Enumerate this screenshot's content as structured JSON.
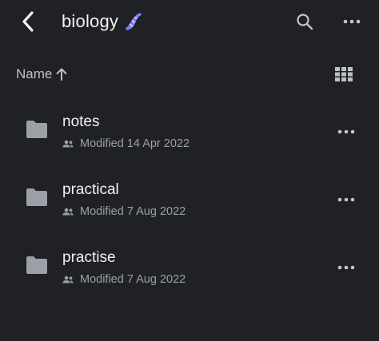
{
  "header": {
    "back_icon": "chevron-left-icon",
    "title": "biology",
    "title_emoji": "dna-icon",
    "search_icon": "search-icon",
    "more_icon": "more-horizontal-icon"
  },
  "sortbar": {
    "label": "Name",
    "direction": "ascending",
    "arrow_icon": "arrow-up-icon",
    "view_toggle_icon": "grid-view-icon"
  },
  "files": [
    {
      "name": "notes",
      "type": "folder",
      "icon": "folder-icon",
      "shared_icon": "people-icon",
      "modified": "Modified 14 Apr 2022",
      "more_icon": "more-horizontal-icon"
    },
    {
      "name": "practical",
      "type": "folder",
      "icon": "folder-icon",
      "shared_icon": "people-icon",
      "modified": "Modified 7 Aug 2022",
      "more_icon": "more-horizontal-icon"
    },
    {
      "name": "practise",
      "type": "folder",
      "icon": "folder-icon",
      "shared_icon": "people-icon",
      "modified": "Modified 7 Aug 2022",
      "more_icon": "more-horizontal-icon"
    }
  ],
  "colors": {
    "background": "#202124",
    "primary_text": "#f1f3f4",
    "secondary_text": "#9aa0a6",
    "icon": "#9aa0a6",
    "folder": "#9aa0a6"
  }
}
